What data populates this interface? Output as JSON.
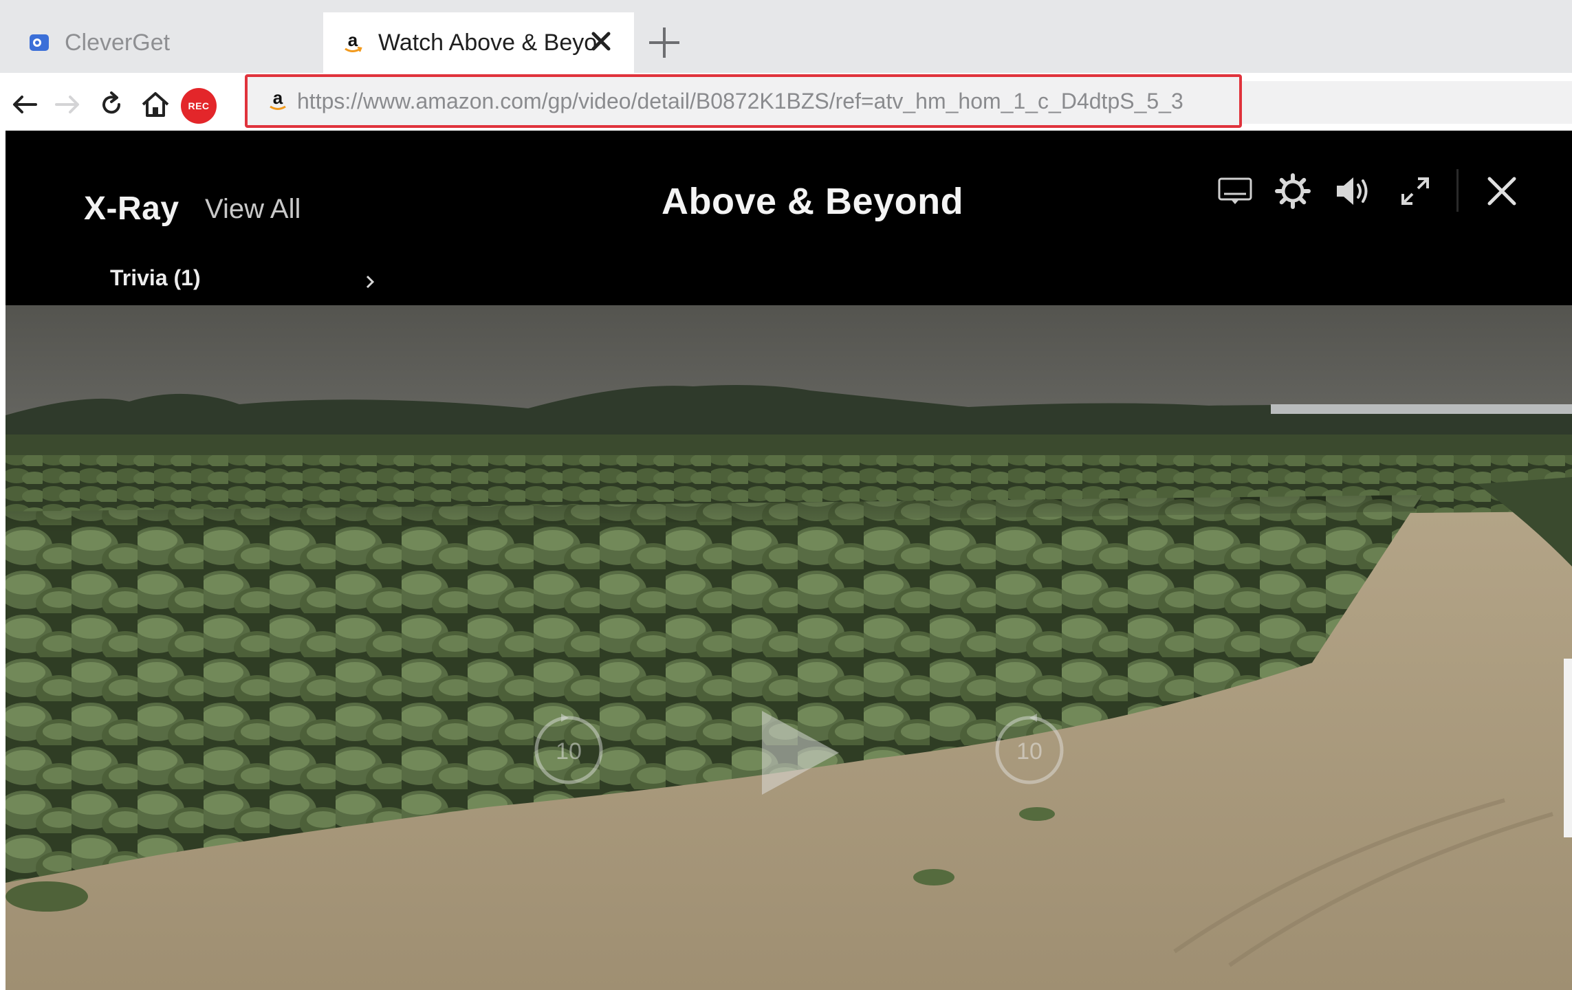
{
  "browser": {
    "tabs": [
      {
        "label": "CleverGet",
        "active": false
      },
      {
        "label": "Watch Above & Beyo",
        "active": true
      }
    ],
    "rec_label": "REC",
    "address": "https://www.amazon.com/gp/video/detail/B0872K1BZS/ref=atv_hm_hom_1_c_D4dtpS_5_3",
    "colors": {
      "address_highlight": "#e0333c",
      "rec": "#e3262a"
    }
  },
  "player": {
    "xray_title": "X-Ray",
    "view_all": "View All",
    "trivia_label": "Trivia (1)",
    "video_title": "Above & Beyond",
    "controls": [
      "subtitles-icon",
      "gear-icon",
      "volume-icon",
      "fullscreen-icon",
      "close-icon"
    ],
    "skip_back_seconds": "10",
    "skip_forward_seconds": "10"
  }
}
